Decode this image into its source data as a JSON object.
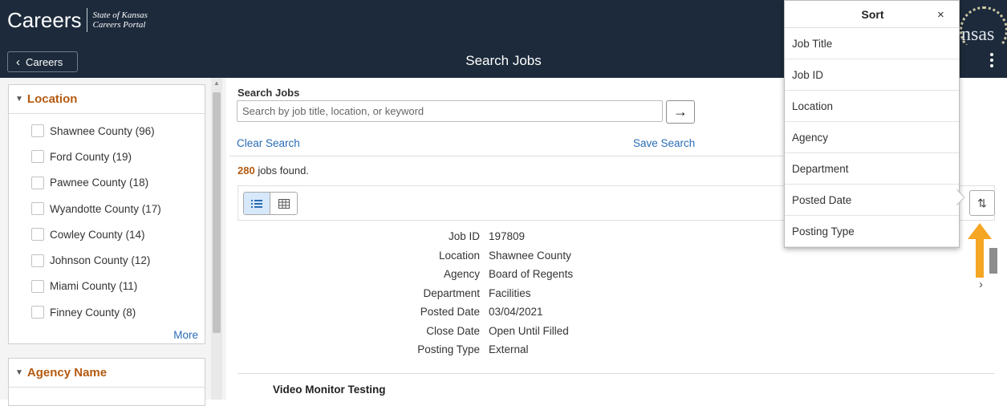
{
  "header": {
    "brand_title": "Careers",
    "brand_line1": "State of Kansas",
    "brand_line2": "Careers Portal",
    "back_label": "Careers",
    "page_title": "Search Jobs",
    "seal_text": "nsas",
    "bg_color": "#1c2a3b"
  },
  "filters": {
    "location": {
      "title": "Location",
      "items": [
        {
          "label": "Shawnee County (96)"
        },
        {
          "label": "Ford County (19)"
        },
        {
          "label": "Pawnee County (18)"
        },
        {
          "label": "Wyandotte County (17)"
        },
        {
          "label": "Cowley County (14)"
        },
        {
          "label": "Johnson County (12)"
        },
        {
          "label": "Miami County (11)"
        },
        {
          "label": "Finney County (8)"
        }
      ],
      "more_label": "More"
    },
    "agency": {
      "title": "Agency Name"
    }
  },
  "search": {
    "label": "Search Jobs",
    "placeholder": "Search by job title, location, or keyword",
    "go_icon": "arrow-right-icon",
    "clear_label": "Clear Search",
    "save_label": "Save Search"
  },
  "results": {
    "count": "280",
    "count_suffix": " jobs found.",
    "view_list_icon": "list-view-icon",
    "view_grid_icon": "grid-view-icon",
    "sort_icon": "sort-icon"
  },
  "job": {
    "labels": [
      "Job ID",
      "Location",
      "Agency",
      "Department",
      "Posted Date",
      "Close Date",
      "Posting Type"
    ],
    "values": [
      "197809",
      "Shawnee County",
      "Board of Regents",
      "Facilities",
      "03/04/2021",
      "Open Until Filled",
      "External"
    ]
  },
  "next_job_title": "Video Monitor Testing",
  "sort_popup": {
    "title": "Sort",
    "close": "×",
    "options": [
      "Job Title",
      "Job ID",
      "Location",
      "Agency",
      "Department",
      "Posted Date",
      "Posting Type"
    ]
  },
  "colors": {
    "accent_orange": "#b45a10",
    "link_blue": "#2a6cb4",
    "highlight_arrow": "#f5a623"
  }
}
